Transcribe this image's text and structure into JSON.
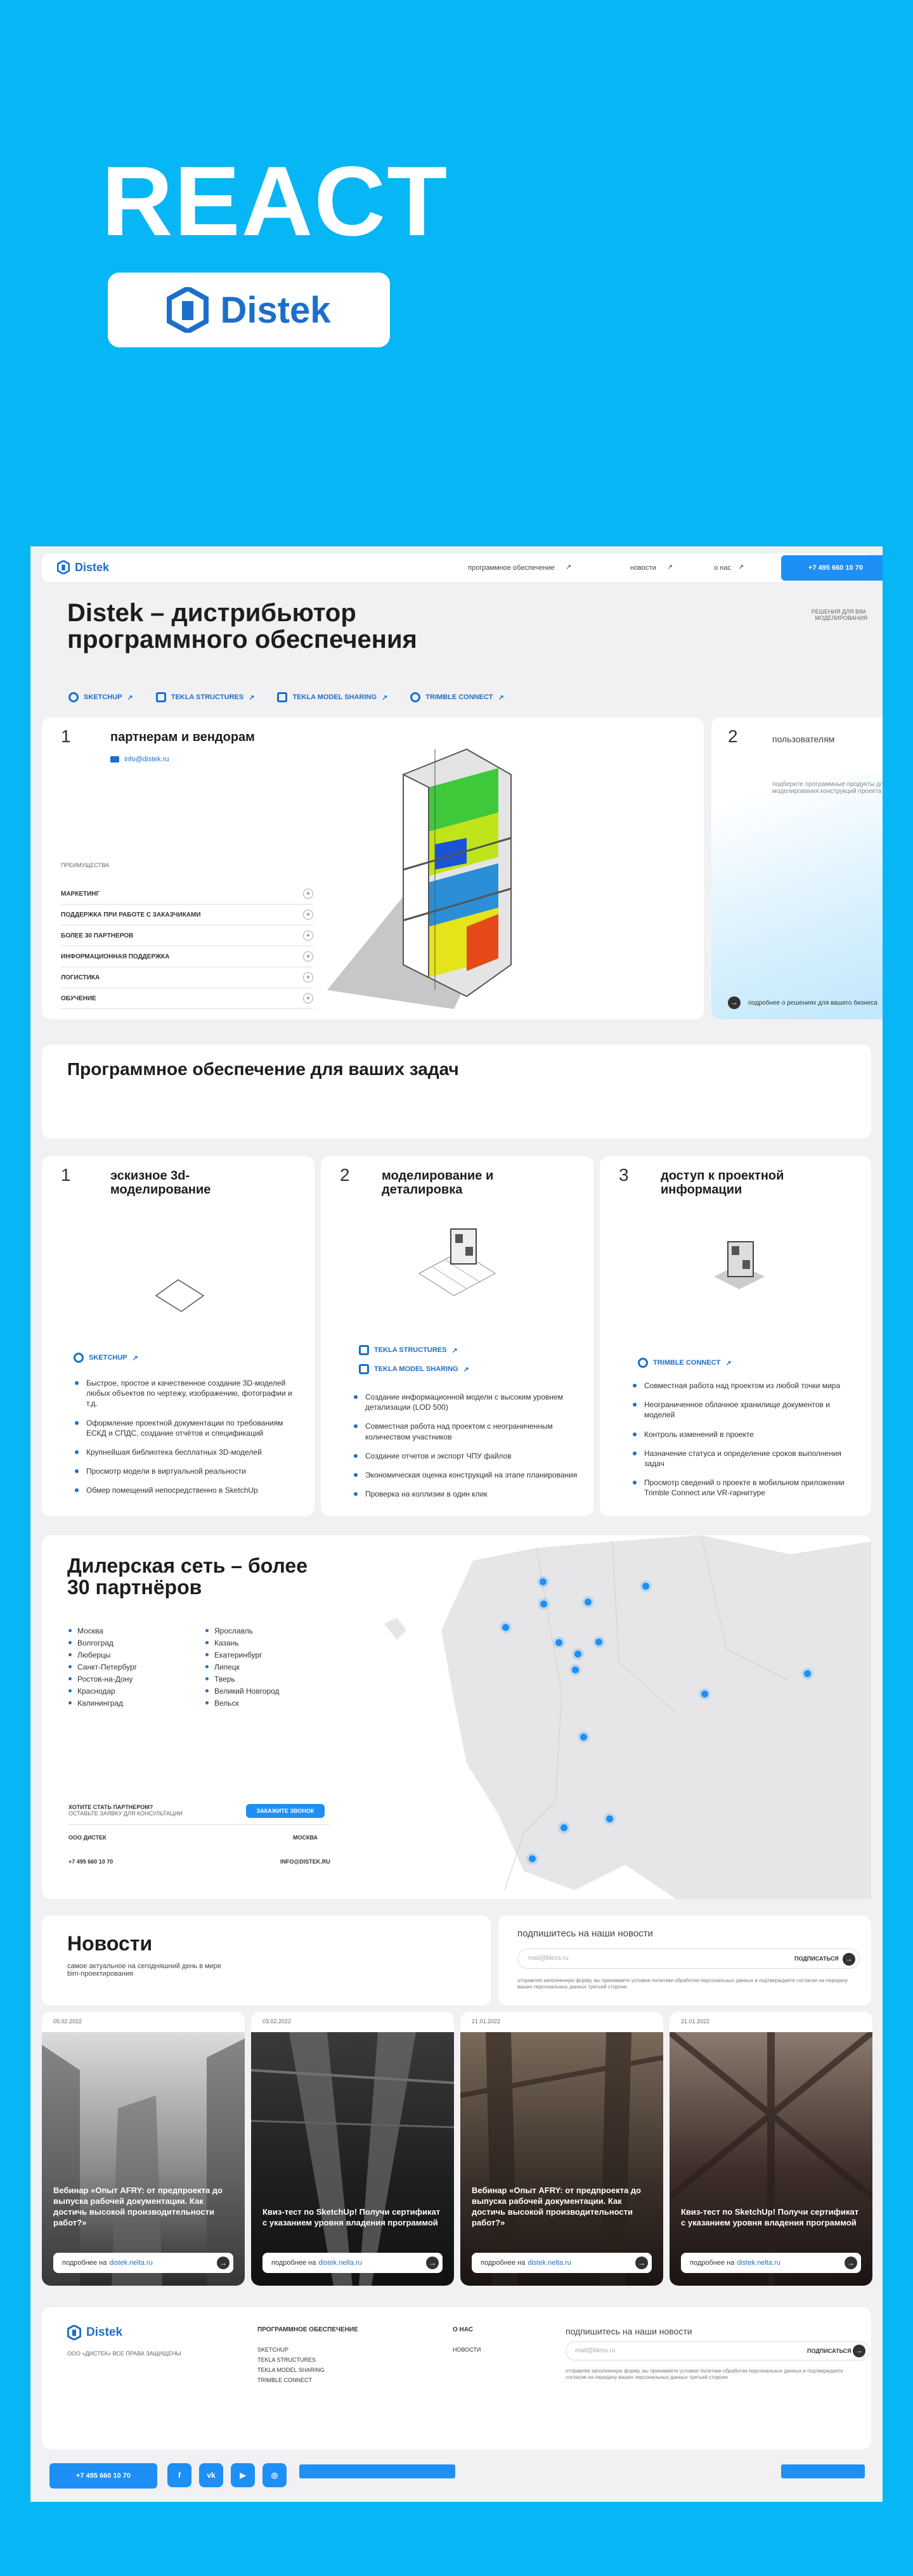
{
  "promo": {
    "title": "REACT",
    "logo_text": "Distek"
  },
  "header": {
    "logo": "Distek",
    "nav": [
      "программное обеспечение",
      "новости",
      "о нас"
    ],
    "phone": "+7 495 660 10 70"
  },
  "hero": {
    "title": "Distek – дистрибьютор программного обеспечения",
    "side_note": "решения для bim-моделирования",
    "tags": [
      "SKETCHUP",
      "TEKLA STRUCTURES",
      "TEKLA MODEL SHARING",
      "TRIMBLE CONNECT"
    ]
  },
  "partners": {
    "num": "1",
    "title": "партнерам и вендорам",
    "email": "info@distek.ru",
    "advantages_label": "преимущества",
    "items": [
      "МАРКЕТИНГ",
      "ПОДДЕРЖКА ПРИ РАБОТЕ С ЗАКАЗЧИКАМИ",
      "БОЛЕЕ 30 ПАРТНЕРОВ",
      "ИНФОРМАЦИОННАЯ ПОДДЕРЖКА",
      "ЛОГИСТИКА",
      "ОБУЧЕНИЕ"
    ]
  },
  "users": {
    "num": "2",
    "title": "пользователям",
    "text": "подберите программные продукты для моделирования конструкций проекта",
    "link": "подробнее о решениях для вашего бизнеса"
  },
  "software": {
    "title": "Программное обеспечение для ваших задач"
  },
  "tasks": [
    {
      "num": "1",
      "title": "эскизное 3d-моделирование",
      "tags": [
        "SKETCHUP"
      ],
      "bullets": [
        "Быстрое, простое и качественное создание 3D-моделей любых объектов по чертежу, изображению, фотографии и т.д.",
        "Оформление проектной документации по требованиям ЕСКД и СПДС, создание отчётов и спецификаций",
        "Крупнейшая библиотека бесплатных 3D-моделей",
        "Просмотр модели в виртуальной реальности",
        "Обмер помещений непосредственно в SketchUp"
      ]
    },
    {
      "num": "2",
      "title": "моделирование и деталировка",
      "tags": [
        "TEKLA STRUCTURES",
        "TEKLA MODEL SHARING"
      ],
      "bullets": [
        "Создание информационной модели с высоким уровнем детализации (LOD 500)",
        "Совместная работа над проектом с неограниченным количеством участников",
        "Создание отчетов и экспорт ЧПУ файлов",
        "Экономическая оценка конструкций на этапе планирования",
        "Проверка на коллизии в один клик"
      ]
    },
    {
      "num": "3",
      "title": "доступ к проектной информации",
      "tags": [
        "TRIMBLE CONNECT"
      ],
      "bullets": [
        "Совместная работа над проектом из любой точки мира",
        "Неограниченное облачное хранилище документов и моделей",
        "Контроль изменений в проекте",
        "Назначение статуса и определение сроков выполнения задач",
        "Просмотр сведений о проекте в мобильном приложении Trimble Connect или VR-гарнитуре"
      ]
    }
  ],
  "dealers": {
    "title": "Дилерская сеть – более 30 партнёров",
    "cities_left": [
      "Москва",
      "Волгоград",
      "Люберцы",
      "Санкт-Петербург",
      "Ростов-на-Дону",
      "Краснодар",
      "Калининград"
    ],
    "cities_right": [
      "Ярославль",
      "Казань",
      "Екатеринбург",
      "Липецк",
      "Тверь",
      "Великий Новгород",
      "Вельск"
    ],
    "become_q": "хотите стать партнером?",
    "become_sub": "оставьте заявку для консультации",
    "become_btn": "ЗАКАЖИТЕ ЗВОНОК",
    "company": "ООО ДИСТЕК",
    "city": "МОСКВА",
    "phone": "+7 495 660 10 70",
    "email": "INFO@DISTEK.RU"
  },
  "news": {
    "title": "Новости",
    "subtitle": "самое актуальное на сегодняшний день в мире bim-проектирования",
    "subscribe_title": "подпишитесь на наши новости",
    "subscribe_placeholder": "mail@bless.ru",
    "subscribe_btn": "ПОДПИСАТЬСЯ",
    "consent": "отправляя заполненную форму, вы принимаете условия политики обработки персональных данных и подтверждаете согласие на передачу ваших персональных данных третьей стороне",
    "more_prefix": "подробнее на",
    "more_link": "distek.nelta.ru",
    "items": [
      {
        "date": "05.02.2022",
        "title": "Вебинар «Опыт AFRY: от предпроекта до выпуска рабочей документации. Как достичь высокой производительности работ?»"
      },
      {
        "date": "03.02.2022",
        "title": "Квиз-тест по SketchUp! Получи сертификат с указанием уровня владения программой"
      },
      {
        "date": "21.01.2022",
        "title": "Вебинар «Опыт AFRY: от предпроекта до выпуска рабочей документации. Как достичь высокой производительности работ?»"
      },
      {
        "date": "21.01.2022",
        "title": "Квиз-тест по SketchUp! Получи сертификат с указанием уровня владения программой"
      }
    ]
  },
  "footer": {
    "logo": "Distek",
    "copyright": "ООО «ДИСТЕК» ВСЕ ПРАВА ЗАЩИЩЕНЫ",
    "col1_title": "ПРОГРАММНОЕ ОБЕСПЕЧЕНИЕ",
    "col1": [
      "SKETCHUP",
      "TEKLA STRUCTURES",
      "TEKLA MODEL SHARING",
      "TRIMBLE CONNECT"
    ],
    "col2_title": "О НАС",
    "col2": [
      "НОВОСТИ"
    ],
    "subscribe_title": "подпишитесь на наши новости",
    "subscribe_placeholder": "mail@bless.ru",
    "subscribe_btn": "ПОДПИСАТЬСЯ",
    "phone": "+7 495 660 10 70",
    "socials": [
      "f",
      "vk",
      "▶",
      "◎"
    ]
  },
  "colors": {
    "bg": "#06b6f5",
    "accent": "#1e8ff5",
    "brand": "#1c6fc9"
  }
}
